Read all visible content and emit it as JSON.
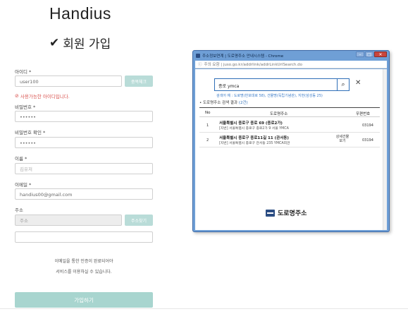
{
  "brand": "Handius",
  "page_title": "회원 가입",
  "form": {
    "id_label": "아이디",
    "id_value": "user100",
    "dup_check_button": "중복체크",
    "id_message": "사용가능한 아이디입니다.",
    "password_label": "비밀번호",
    "password_value": "••••••",
    "password_confirm_label": "비밀번호 확인",
    "password_confirm_value": "••••••",
    "name_label": "이름",
    "name_placeholder": "김유저",
    "email_label": "이메일",
    "email_value": "handius00@gmail.com",
    "address_label": "주소",
    "address_placeholder": "주소",
    "address_search_button": "주소찾기",
    "address_detail_value": "",
    "required_mark": "*",
    "notice_line1": "이메일을 통한 인증이 완료되어야",
    "notice_line2": "서비스를 이용하실 수 있습니다.",
    "submit_button": "가입하기"
  },
  "popup": {
    "window_title": "주소정보연계 | 도로명주소 안내시스템 - Chrome",
    "info_icon": "info-icon",
    "url": "주의 요함 | juso.go.kr/addrlink/addrLinkUrlSearch.do",
    "search_value": "종로 ymca",
    "search_hint": "검색어 예 : 도로명(반포대로 58), 건물명(독립기념관), 지번(삼성동 25)",
    "result_label": "도로명주소 검색 결과",
    "result_count": "(2건)",
    "headers": {
      "no": "No",
      "road": "도로명주소",
      "zip": "우편번호"
    },
    "rows": [
      {
        "no": "1",
        "road": "서울특별시 종로구 종로 69 (종로2가)",
        "jibun": "[지번] 서울특별시 종로구 종로2가 9 서울 YMCA",
        "detail_line1": "",
        "detail_line2": "",
        "zip": "03194"
      },
      {
        "no": "2",
        "road": "서울특별시 종로구 종로11길 11 (관서동)",
        "jibun": "[지번] 서울특별시 종로구 관서동 235 YMCA회관",
        "detail_line1": "상세건물",
        "detail_line2": "보기",
        "zip": "03194"
      }
    ],
    "footer_logo_text": "도로명주소"
  }
}
